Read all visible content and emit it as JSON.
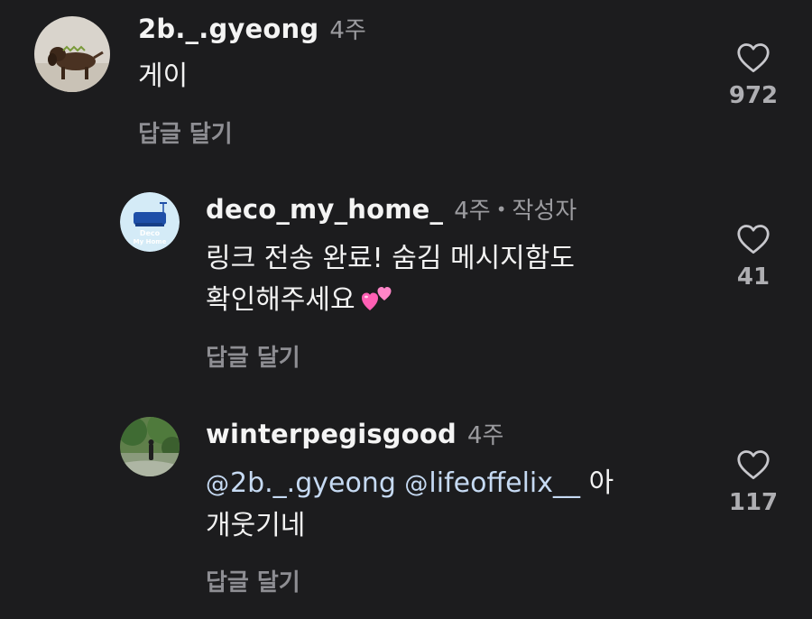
{
  "comments": [
    {
      "username": "2b._.gyeong",
      "time": "4주",
      "text": "게이",
      "reply_label": "답글 달기",
      "likes": "972"
    },
    {
      "username": "deco_my_home_",
      "time": "4주",
      "author_badge": "작성자",
      "line1": "링크 전송 완료! 숨김 메시지함도",
      "line2": "확인해주세요",
      "emoji": "two-hearts",
      "avatar_text_1": "Deco",
      "avatar_text_2": "My Home",
      "reply_label": "답글 달기",
      "likes": "41"
    },
    {
      "username": "winterpegisgood",
      "time": "4주",
      "mention1": "2b._.gyeong",
      "mention2": "lifeoffelix__",
      "text_tail": "아",
      "line2": "개웃기네",
      "reply_label": "답글 달기",
      "likes": "117"
    }
  ],
  "colors": {
    "background": "#1c1c1e",
    "mention": "#c6daf3",
    "muted": "#9b9b9f"
  }
}
